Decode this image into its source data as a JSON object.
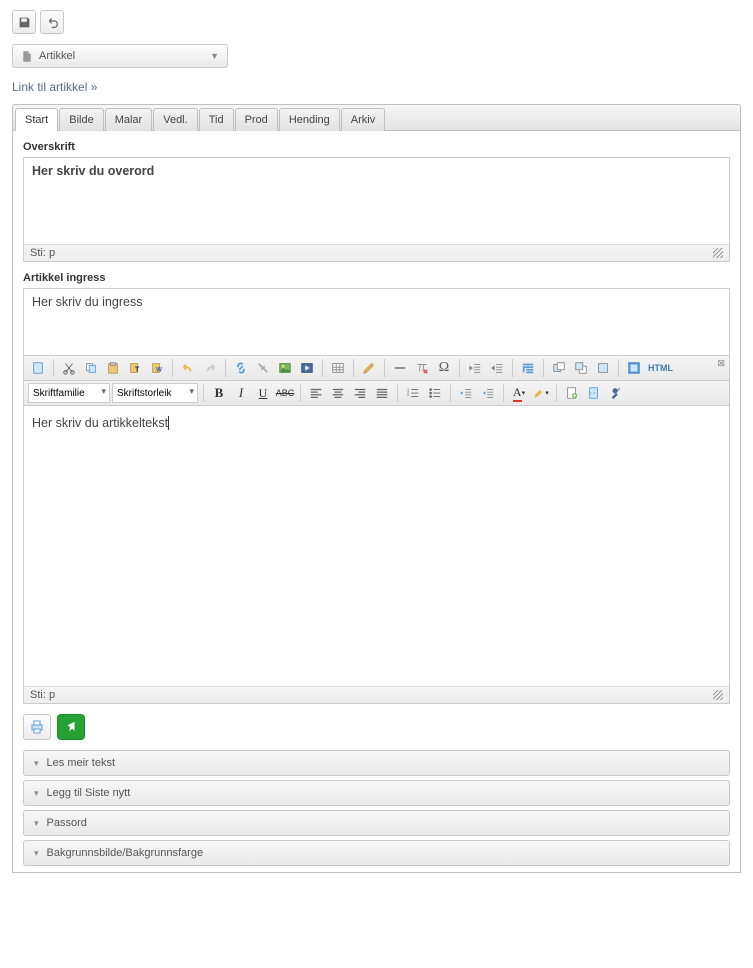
{
  "toolbar": {
    "save_title": "Lagre",
    "undo_title": "Angre"
  },
  "type_select": {
    "label": "Artikkel"
  },
  "link": {
    "text": "Link til artikkel »"
  },
  "tabs": [
    {
      "label": "Start",
      "active": true
    },
    {
      "label": "Bilde"
    },
    {
      "label": "Malar"
    },
    {
      "label": "Vedl."
    },
    {
      "label": "Tid"
    },
    {
      "label": "Prod"
    },
    {
      "label": "Hending"
    },
    {
      "label": "Arkiv"
    }
  ],
  "fields": {
    "overskrift": {
      "label": "Overskrift",
      "value": "Her skriv du overord",
      "status": "Sti: p"
    },
    "ingress": {
      "label": "Artikkel ingress",
      "value": "Her skriv du ingress"
    },
    "body": {
      "value": "Her skriv du artikkeltekst",
      "status": "Sti: p"
    }
  },
  "rte": {
    "font_family_label": "Skriftfamilie",
    "font_size_label": "Skriftstorleik",
    "html_label": "HTML"
  },
  "accordions": [
    {
      "label": "Les meir tekst"
    },
    {
      "label": "Legg til Siste nytt"
    },
    {
      "label": "Passord"
    },
    {
      "label": "Bakgrunnsbilde/Bakgrunnsfarge"
    }
  ]
}
